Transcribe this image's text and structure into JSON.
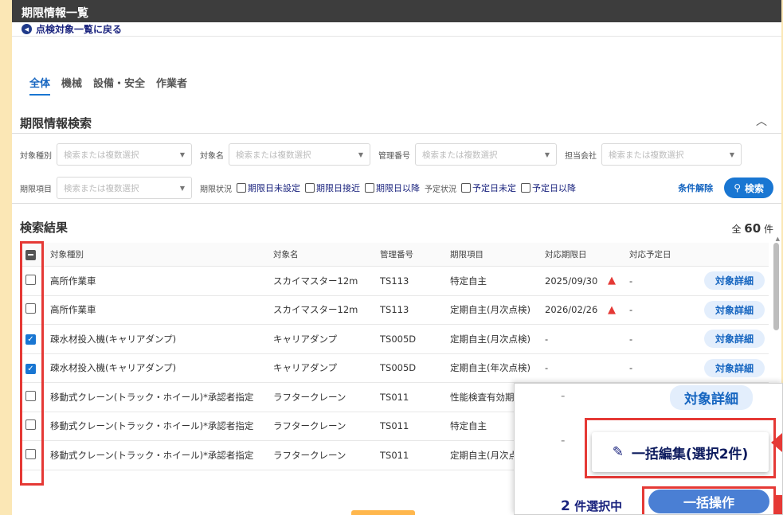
{
  "header": {
    "title": "期限情報一覧"
  },
  "back_link": {
    "label": "点検対象一覧に戻る"
  },
  "tabs": [
    "全体",
    "機械",
    "設備・安全",
    "作業者"
  ],
  "search": {
    "title": "期限情報検索",
    "placeholder": "検索または複数選択",
    "labels": {
      "type": "対象種別",
      "name": "対象名",
      "mgmt_no": "管理番号",
      "company": "担当会社",
      "item": "期限項目",
      "status": "期限状況",
      "plan_status": "予定状況"
    },
    "status_options": [
      "期限日未設定",
      "期限日接近",
      "期限日以降"
    ],
    "plan_options": [
      "予定日未定",
      "予定日以降"
    ],
    "clear_label": "条件解除",
    "search_label": "検索"
  },
  "results": {
    "title": "検索結果",
    "total_prefix": "全",
    "total": "60",
    "total_suffix": "件",
    "columns": {
      "type": "対象種別",
      "name": "対象名",
      "mgmt_no": "管理番号",
      "item": "期限項目",
      "due": "対応期限日",
      "planned": "対応予定日"
    },
    "detail_label": "対象詳細",
    "rows": [
      {
        "checked": false,
        "type": "高所作業車",
        "name": "スカイマスター12m",
        "mgmt_no": "TS113",
        "item": "特定自主",
        "due": "2025/09/30",
        "warn": true,
        "planned": "-",
        "detail": true
      },
      {
        "checked": false,
        "type": "高所作業車",
        "name": "スカイマスター12m",
        "mgmt_no": "TS113",
        "item": "定期自主(月次点検)",
        "due": "2026/02/26",
        "warn": true,
        "planned": "-",
        "detail": true
      },
      {
        "checked": true,
        "type": "疎水材投入機(キャリアダンプ)",
        "name": "キャリアダンプ",
        "mgmt_no": "TS005D",
        "item": "定期自主(月次点検)",
        "due": "-",
        "warn": false,
        "planned": "-",
        "detail": true
      },
      {
        "checked": true,
        "type": "疎水材投入機(キャリアダンプ)",
        "name": "キャリアダンプ",
        "mgmt_no": "TS005D",
        "item": "定期自主(年次点検)",
        "due": "-",
        "warn": false,
        "planned": "-",
        "detail": true
      },
      {
        "checked": false,
        "type": "移動式クレーン(トラック・ホイール)*承認者指定",
        "name": "ラフタークレーン",
        "mgmt_no": "TS011",
        "item": "性能検査有効期",
        "due": "",
        "warn": false,
        "planned": "",
        "detail": false
      },
      {
        "checked": false,
        "type": "移動式クレーン(トラック・ホイール)*承認者指定",
        "name": "ラフタークレーン",
        "mgmt_no": "TS011",
        "item": "特定自主",
        "due": "",
        "warn": false,
        "planned": "",
        "detail": false
      },
      {
        "checked": false,
        "type": "移動式クレーン(トラック・ホイール)*承認者指定",
        "name": "ラフタークレーン",
        "mgmt_no": "TS011",
        "item": "定期自主(月次点",
        "due": "",
        "warn": false,
        "planned": "",
        "detail": false
      }
    ]
  },
  "zoom_panel": {
    "dash": "-",
    "detail_label": "対象詳細",
    "bulk_edit_label": "一括編集(選択2件)",
    "selected_count": "2",
    "selected_suffix": "件選択中",
    "bulk_action_label": "一括操作"
  },
  "colors": {
    "accent": "#1976d2",
    "highlight": "#e53935",
    "header_bg": "#3d3d3d",
    "page_bg": "#fbe7b5"
  }
}
